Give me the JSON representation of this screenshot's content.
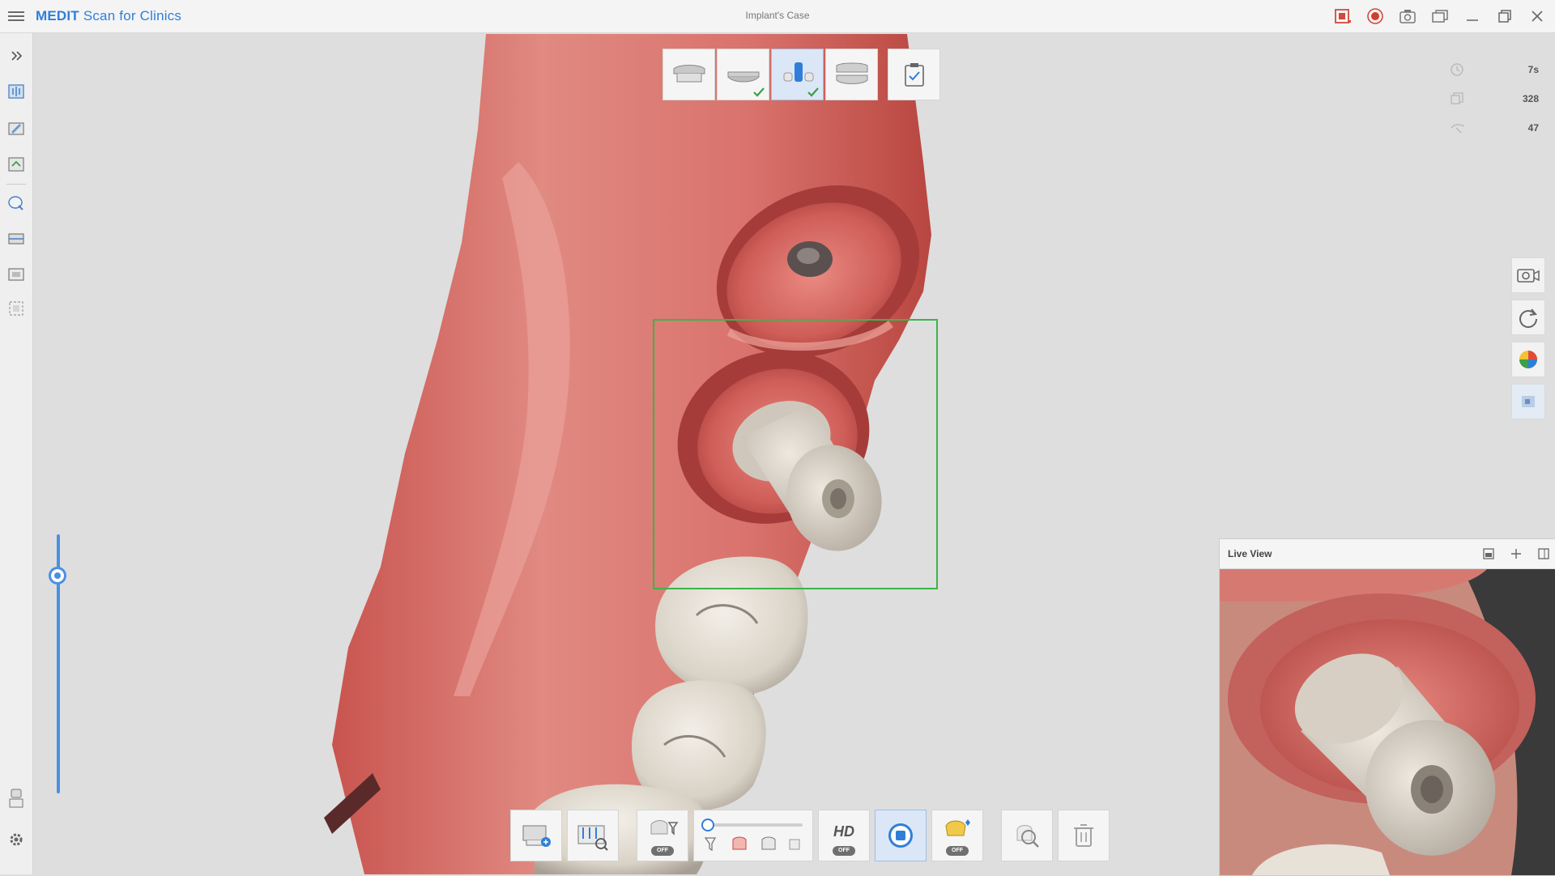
{
  "titlebar": {
    "app_name_bold": "MEDIT",
    "app_name_rest": " Scan for Clinics",
    "case_title": "Implant's Case",
    "icons": [
      "screen-record-icon",
      "record-icon",
      "screenshot-icon",
      "window-switch-icon",
      "minimize-icon",
      "maximize-icon",
      "close-icon"
    ]
  },
  "left_toolbar": {
    "icons": [
      "expand-chevrons-icon",
      "scan-data-icon",
      "edit-data-icon",
      "align-data-icon",
      "smart-select-icon",
      "occlusion-icon",
      "screen-capture-icon",
      "frame-select-icon",
      "tray-icon",
      "settings-gear-icon"
    ]
  },
  "stages": {
    "items": [
      {
        "name": "maxilla",
        "done": false,
        "active": false
      },
      {
        "name": "mandible",
        "done": true,
        "active": false
      },
      {
        "name": "scan-body",
        "done": true,
        "active": true
      },
      {
        "name": "occlusion",
        "done": false,
        "active": false
      }
    ],
    "finish_icon": "clipboard-check-icon"
  },
  "stats": {
    "time": "7s",
    "frames": "328",
    "count": "47"
  },
  "right_toolbar": {
    "icons": [
      "camera-view-icon",
      "reset-view-icon",
      "reliability-map-icon",
      "texture-toggle-icon"
    ]
  },
  "bottom_toolbar": {
    "items": [
      "data-display-icon",
      "scan-filter-icon",
      "ai-filter-icon",
      "filter-level-slider",
      "hd-icon",
      "scan-stop-icon",
      "smart-color-icon",
      "zoom-search-icon",
      "delete-icon"
    ],
    "hd_label": "HD",
    "toggle_label": "OFF"
  },
  "live_view": {
    "title": "Live View"
  },
  "colors": {
    "accent": "#2f7fd9",
    "selection": "#3ab54a",
    "gum": "#d9726c",
    "tooth": "#e8e2d8"
  }
}
